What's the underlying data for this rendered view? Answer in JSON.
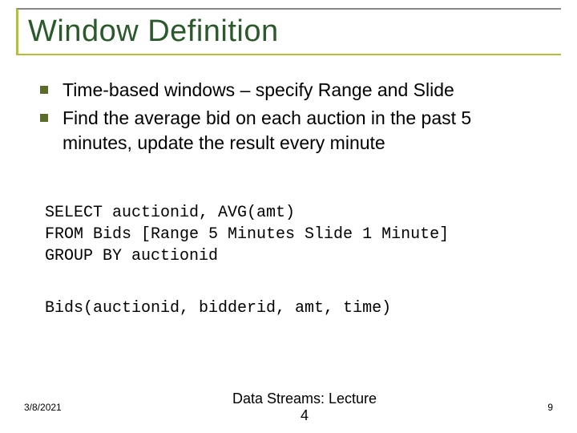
{
  "title": "Window Definition",
  "bullets": [
    "Time-based windows – specify Range and Slide",
    "Find the average bid on each auction in the past 5 minutes, update the result every minute"
  ],
  "code1_line1": "SELECT auctionid, AVG(amt)",
  "code1_line2": "FROM Bids [Range 5 Minutes Slide 1 Minute]",
  "code1_line3": "GROUP BY auctionid",
  "code2": "Bids(auctionid, bidderid, amt, time)",
  "footer": {
    "date": "3/8/2021",
    "center_line1": "Data Streams: Lecture",
    "center_line2": "4",
    "page": "9"
  }
}
